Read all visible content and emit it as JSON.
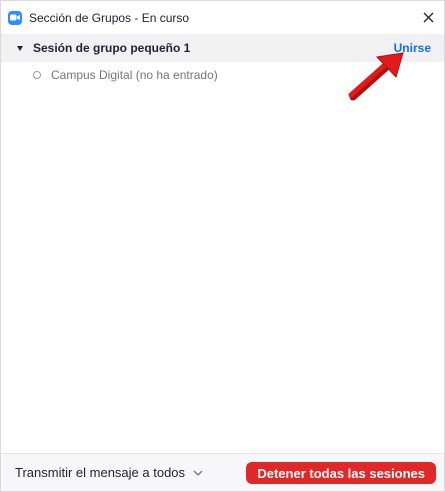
{
  "window": {
    "title": "Sección de Grupos - En curso"
  },
  "group": {
    "name": "Sesión de grupo pequeño 1",
    "join_label": "Unirse"
  },
  "participants": [
    {
      "label": "Campus Digital (no ha entrado)"
    }
  ],
  "footer": {
    "broadcast_label": "Transmitir el mensaje a todos",
    "stop_label": "Detener todas las sesiones"
  },
  "colors": {
    "accent": "#0e71eb",
    "danger": "#e02828",
    "app_icon": "#2d8cff",
    "annotation_arrow": "#e11b1b"
  }
}
